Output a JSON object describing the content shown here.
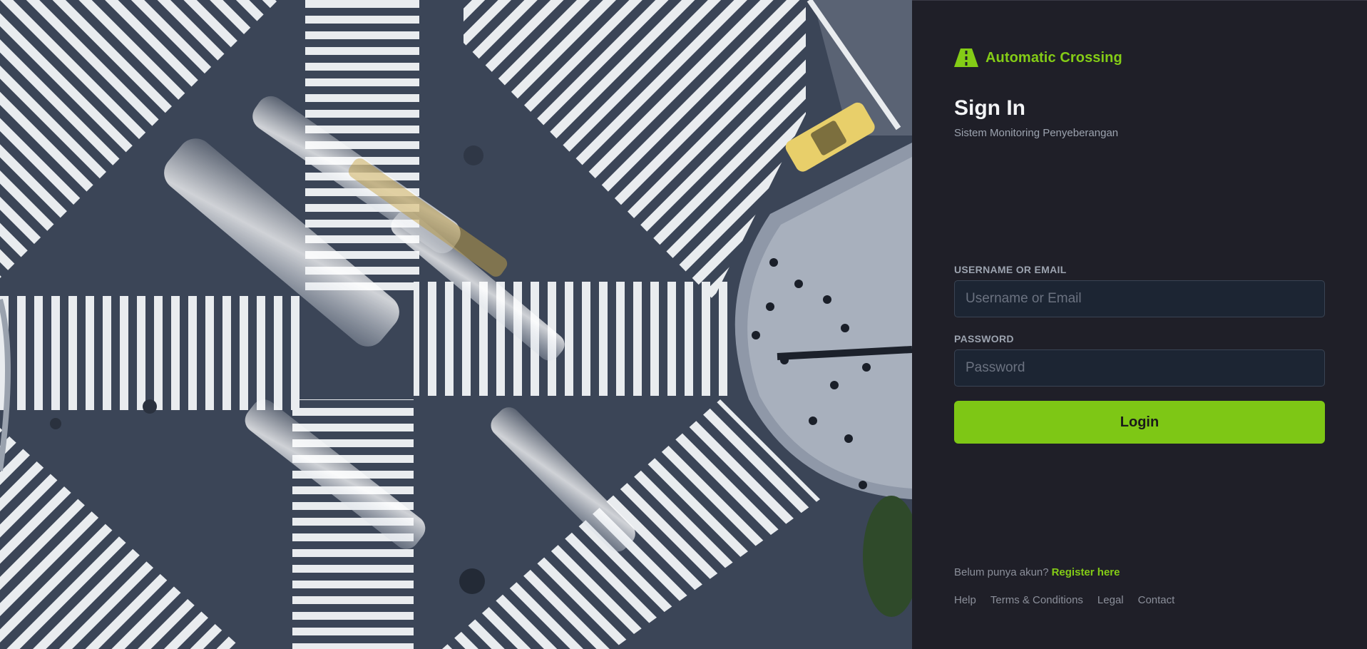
{
  "hero": {
    "image_description_icon": "crosswalk-aerial-image"
  },
  "brand": {
    "name": "Automatic Crossing",
    "icon": "road-icon",
    "color": "#84cc16"
  },
  "signin": {
    "title": "Sign In",
    "subtitle": "Sistem Monitoring Penyeberangan"
  },
  "form": {
    "username_label": "USERNAME OR EMAIL",
    "username_placeholder": "Username or Email",
    "username_value": "",
    "password_label": "PASSWORD",
    "password_placeholder": "Password",
    "password_value": "",
    "login_label": "Login"
  },
  "register": {
    "prompt": "Belum punya akun?",
    "link": "Register here"
  },
  "footer": {
    "links": [
      "Help",
      "Terms & Conditions",
      "Legal",
      "Contact"
    ]
  },
  "colors": {
    "accent": "#84cc16",
    "panel_bg": "#1f1f28",
    "input_bg": "#1c2533"
  }
}
